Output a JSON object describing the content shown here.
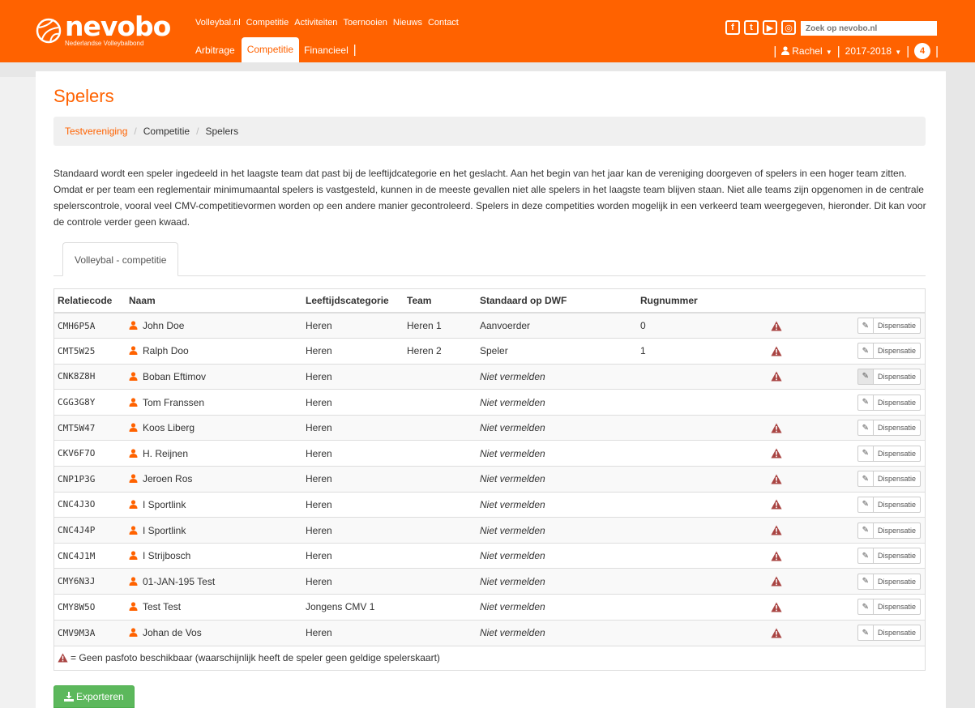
{
  "brand": {
    "name": "nevobo",
    "subtitle": "Nederlandse Volleybalbond",
    "accent": "#ff6200"
  },
  "mainnav": [
    "Volleybal.nl",
    "Competitie",
    "Activiteiten",
    "Toernooien",
    "Nieuws",
    "Contact"
  ],
  "subnav": {
    "items": [
      "Arbitrage",
      "Competitie",
      "Financieel"
    ],
    "active": "Competitie"
  },
  "social": [
    {
      "icon": "facebook-icon",
      "glyph": "f"
    },
    {
      "icon": "twitter-icon",
      "glyph": "t"
    },
    {
      "icon": "youtube-icon",
      "glyph": "▶"
    },
    {
      "icon": "instagram-icon",
      "glyph": "◎"
    }
  ],
  "search": {
    "placeholder": "Zoek op nevobo.nl"
  },
  "user": {
    "name": "Rachel",
    "season": "2017-2018",
    "notifications": "4"
  },
  "page": {
    "title": "Spelers",
    "breadcrumb": [
      "Testvereniging",
      "Competitie",
      "Spelers"
    ],
    "intro": "Standaard wordt een speler ingedeeld in het laagste team dat past bij de leeftijdcategorie en het geslacht. Aan het begin van het jaar kan de vereniging doorgeven of spelers in een hoger team zitten. Omdat er per team een reglementair minimumaantal spelers is vastgesteld, kunnen in de meeste gevallen niet alle spelers in het laagste team blijven staan. Niet alle teams zijn opgenomen in de centrale spelerscontrole, vooral veel CMV-competitievormen worden op een andere manier gecontroleerd. Spelers in deze competities worden mogelijk in een verkeerd team weergegeven, hieronder. Dit kan voor de controle verder geen kwaad.",
    "tab": "Volleybal - competitie"
  },
  "table": {
    "headers": [
      "Relatiecode",
      "Naam",
      "Leeftijdscategorie",
      "Team",
      "Standaard op DWF",
      "Rugnummer",
      "",
      ""
    ],
    "button_label": "Dispensatie",
    "rows": [
      {
        "code": "CMH6P5A",
        "name": "John Doe",
        "cat": "Heren",
        "team": "Heren 1",
        "dwf": "Aanvoerder",
        "italic": false,
        "rug": "0",
        "warn": true
      },
      {
        "code": "CMT5W25",
        "name": "Ralph Doo",
        "cat": "Heren",
        "team": "Heren 2",
        "dwf": "Speler",
        "italic": false,
        "rug": "1",
        "warn": true
      },
      {
        "code": "CNK8Z8H",
        "name": "Boban Eftimov",
        "cat": "Heren",
        "team": "",
        "dwf": "Niet vermelden",
        "italic": true,
        "rug": "",
        "warn": true,
        "pressed": true
      },
      {
        "code": "CGG3G8Y",
        "name": "Tom Franssen",
        "cat": "Heren",
        "team": "",
        "dwf": "Niet vermelden",
        "italic": true,
        "rug": "",
        "warn": false
      },
      {
        "code": "CMT5W47",
        "name": "Koos Liberg",
        "cat": "Heren",
        "team": "",
        "dwf": "Niet vermelden",
        "italic": true,
        "rug": "",
        "warn": true
      },
      {
        "code": "CKV6F7O",
        "name": "H. Reijnen",
        "cat": "Heren",
        "team": "",
        "dwf": "Niet vermelden",
        "italic": true,
        "rug": "",
        "warn": true
      },
      {
        "code": "CNP1P3G",
        "name": "Jeroen Ros",
        "cat": "Heren",
        "team": "",
        "dwf": "Niet vermelden",
        "italic": true,
        "rug": "",
        "warn": true
      },
      {
        "code": "CNC4J3O",
        "name": "I Sportlink",
        "cat": "Heren",
        "team": "",
        "dwf": "Niet vermelden",
        "italic": true,
        "rug": "",
        "warn": true
      },
      {
        "code": "CNC4J4P",
        "name": "I Sportlink",
        "cat": "Heren",
        "team": "",
        "dwf": "Niet vermelden",
        "italic": true,
        "rug": "",
        "warn": true
      },
      {
        "code": "CNC4J1M",
        "name": "I Strijbosch",
        "cat": "Heren",
        "team": "",
        "dwf": "Niet vermelden",
        "italic": true,
        "rug": "",
        "warn": true
      },
      {
        "code": "CMY6N3J",
        "name": "01-JAN-195 Test",
        "cat": "Heren",
        "team": "",
        "dwf": "Niet vermelden",
        "italic": true,
        "rug": "",
        "warn": true
      },
      {
        "code": "CMY8W5O",
        "name": "Test Test",
        "cat": "Jongens CMV 1",
        "team": "",
        "dwf": "Niet vermelden",
        "italic": true,
        "rug": "",
        "warn": true
      },
      {
        "code": "CMV9M3A",
        "name": "Johan de Vos",
        "cat": "Heren",
        "team": "",
        "dwf": "Niet vermelden",
        "italic": true,
        "rug": "",
        "warn": true
      }
    ],
    "legend": "= Geen pasfoto beschikbaar (waarschijnlijk heeft de speler geen geldige spelerskaart)"
  },
  "export": {
    "label": "Exporteren"
  },
  "colors": {
    "warning": "#a94442",
    "success": "#5cb85c"
  }
}
